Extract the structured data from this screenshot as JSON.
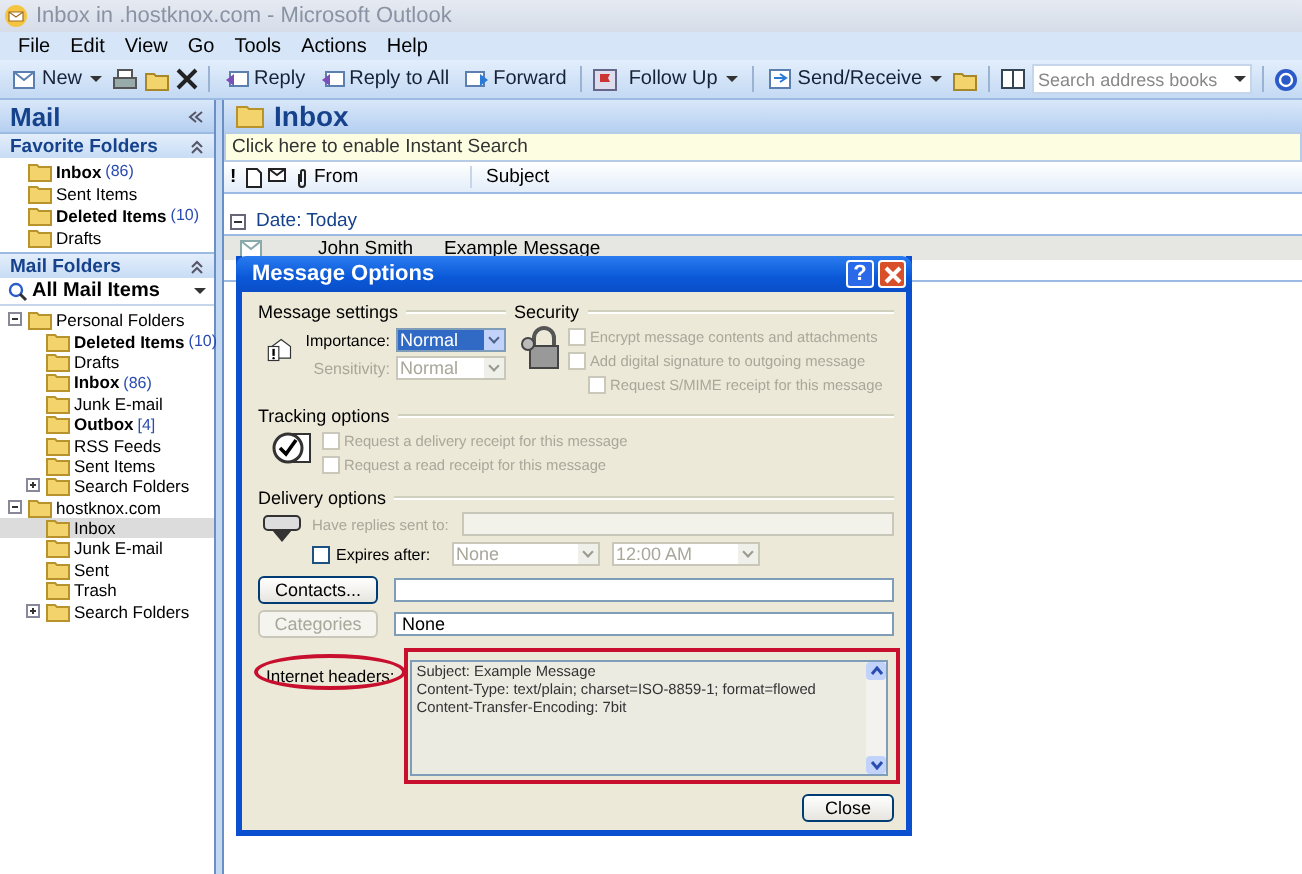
{
  "window": {
    "title": "Inbox in .hostknox.com - Microsoft Outlook"
  },
  "menu": [
    "File",
    "Edit",
    "View",
    "Go",
    "Tools",
    "Actions",
    "Help"
  ],
  "toolbar": {
    "new": "New",
    "reply": "Reply",
    "reply_all": "Reply to All",
    "forward": "Forward",
    "follow_up": "Follow Up",
    "send_receive": "Send/Receive",
    "search": {
      "placeholder": "Search address books"
    }
  },
  "navigation": {
    "title": "Mail",
    "favorites": {
      "title": "Favorite Folders",
      "items": [
        {
          "name": "Inbox",
          "count": "(86)",
          "bold": true
        },
        {
          "name": "Sent Items",
          "bold": false
        },
        {
          "name": "Deleted Items",
          "count": "(10)",
          "bold": true
        },
        {
          "name": "Drafts",
          "bold": false
        }
      ]
    },
    "mail_folders": {
      "title": "Mail Folders",
      "view": "All Mail Items",
      "tree": [
        {
          "name": "Personal Folders",
          "expanded": true,
          "children": [
            {
              "name": "Deleted Items",
              "count": "(10)",
              "bold": true,
              "selected": false
            },
            {
              "name": "Drafts",
              "bold": false,
              "selected": false
            },
            {
              "name": "Inbox",
              "count": "(86)",
              "bold": true,
              "selected": false
            },
            {
              "name": "Junk E-mail",
              "bold": false,
              "selected": false
            },
            {
              "name": "Outbox",
              "count": "[4]",
              "bold": true,
              "selected": false
            },
            {
              "name": "RSS Feeds",
              "bold": false,
              "selected": false
            },
            {
              "name": "Sent Items",
              "bold": false,
              "selected": false
            },
            {
              "name": "Search Folders",
              "bold": false,
              "selected": false,
              "expanded": false
            }
          ]
        },
        {
          "name": "hostknox.com",
          "expanded": true,
          "children": [
            {
              "name": "Inbox",
              "bold": false,
              "selected": true
            },
            {
              "name": "Junk E-mail",
              "bold": false,
              "selected": false
            },
            {
              "name": "Sent",
              "bold": false,
              "selected": false
            },
            {
              "name": "Trash",
              "bold": false,
              "selected": false
            },
            {
              "name": "Search Folders",
              "bold": false,
              "selected": false,
              "expanded": false
            }
          ]
        }
      ]
    }
  },
  "inbox": {
    "title": "Inbox",
    "instant_search": "Click here to enable Instant Search",
    "columns": {
      "importance": "!",
      "from": "From",
      "subject": "Subject"
    },
    "group": {
      "label": "Date: Today",
      "expanded": true
    },
    "messages": [
      {
        "from": "John Smith",
        "subject": "Example Message"
      }
    ]
  },
  "dialog": {
    "title": "Message Options",
    "help": "?",
    "message_settings": {
      "label": "Message settings",
      "importance": {
        "label": "Importance:",
        "value": "Normal",
        "focused": true,
        "disabled": false
      },
      "sensitivity": {
        "label": "Sensitivity:",
        "value": "Normal",
        "focused": false,
        "disabled": true
      }
    },
    "security": {
      "label": "Security",
      "options": [
        {
          "label": "Encrypt message contents and attachments",
          "checked": false,
          "disabled": true
        },
        {
          "label": "Add digital signature to outgoing message",
          "checked": false,
          "disabled": true,
          "children": [
            {
              "label": "Request S/MIME receipt for this message",
              "checked": false,
              "disabled": true
            }
          ]
        }
      ]
    },
    "tracking": {
      "label": "Tracking options",
      "options": [
        {
          "label": "Request a delivery receipt for this message",
          "checked": false,
          "disabled": true
        },
        {
          "label": "Request a read receipt for this message",
          "checked": false,
          "disabled": true
        }
      ]
    },
    "delivery": {
      "label": "Delivery options",
      "replies": {
        "label": "Have replies sent to:",
        "disabled": true
      },
      "expires": {
        "label": "Expires after:",
        "checked": false,
        "date": "None",
        "time": "12:00 AM",
        "disabled": true
      }
    },
    "contacts": {
      "button": "Contacts...",
      "disabled": false
    },
    "categories": {
      "button": "Categories",
      "disabled": true,
      "value": "None"
    },
    "headers": {
      "label": "Internet headers:",
      "lines": [
        "Subject: Example Message",
        "Content-Type: text/plain; charset=ISO-8859-1; format=flowed",
        "Content-Transfer-Encoding: 7bit"
      ]
    },
    "close": "Close"
  }
}
